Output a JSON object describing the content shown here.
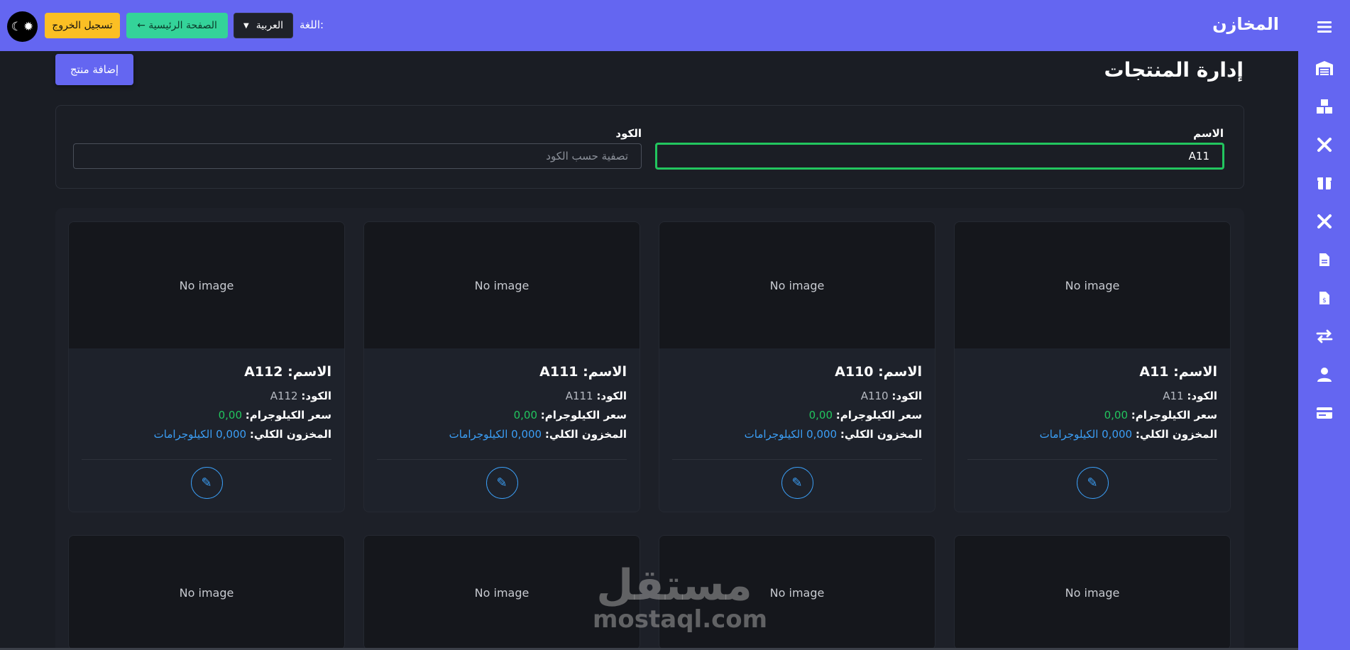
{
  "app": {
    "title": "المخازن",
    "language_label": "اللغة:",
    "language_value": "العربية",
    "home_label": "← الصفحة الرئيسية",
    "logout_label": "تسجيل الخروج"
  },
  "sidebar": {
    "items": [
      {
        "icon": "menu-icon"
      },
      {
        "icon": "warehouse-icon"
      },
      {
        "icon": "boxes-icon"
      },
      {
        "icon": "tools-icon"
      },
      {
        "icon": "box-open-icon"
      },
      {
        "icon": "tools-alt-icon"
      },
      {
        "icon": "document-icon"
      },
      {
        "icon": "invoice-icon"
      },
      {
        "icon": "transfer-icon"
      },
      {
        "icon": "user-icon"
      },
      {
        "icon": "id-card-icon"
      }
    ]
  },
  "page": {
    "title": "إدارة المنتجات",
    "add_label": "إضافة منتج"
  },
  "filters": {
    "name_label": "الاسم",
    "name_value": "A11",
    "code_label": "الكود",
    "code_placeholder": "تصفية حسب الكود"
  },
  "labels": {
    "no_image": "No image",
    "name_prefix": "الاسم:",
    "code_prefix": "الكود:",
    "price_prefix": "سعر الكيلوجرام:",
    "stock_prefix": "المخزون الكلي:"
  },
  "products": [
    {
      "name": "A11",
      "code": "A11",
      "price": "0,00",
      "stock": "0,000 الكيلوجرامات"
    },
    {
      "name": "A110",
      "code": "A110",
      "price": "0,00",
      "stock": "0,000 الكيلوجرامات"
    },
    {
      "name": "A111",
      "code": "A111",
      "price": "0,00",
      "stock": "0,000 الكيلوجرامات"
    },
    {
      "name": "A112",
      "code": "A112",
      "price": "0,00",
      "stock": "0,000 الكيلوجرامات"
    }
  ],
  "watermark": {
    "arabic": "مستقل",
    "latin": "mostaql.com"
  },
  "colors": {
    "accent": "#6466f1",
    "logout": "#fbbf24",
    "home": "#34d399",
    "price": "#22c55e",
    "stock": "#3b9ef5",
    "background": "#1a1d24"
  }
}
